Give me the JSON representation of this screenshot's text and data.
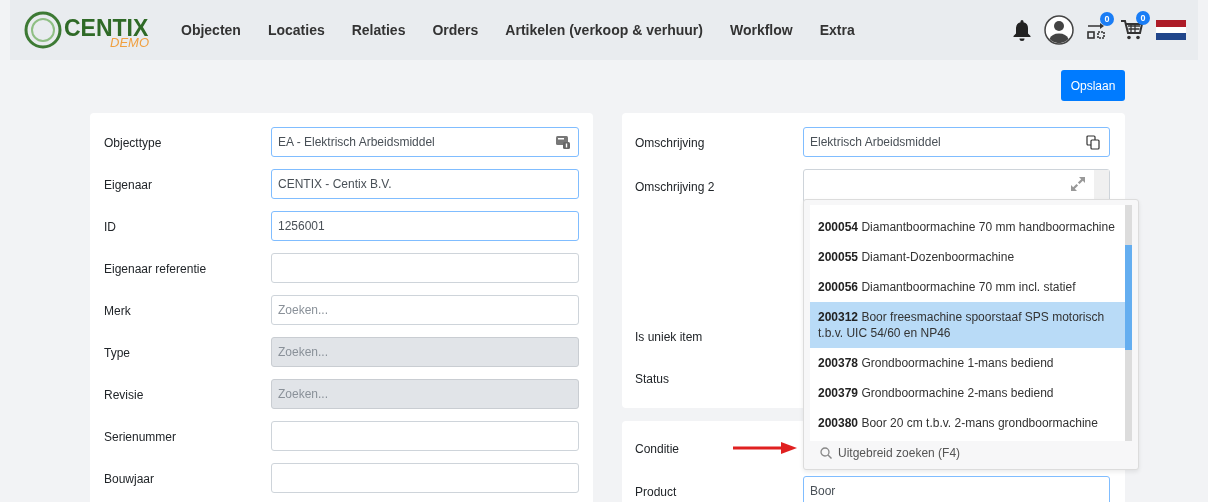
{
  "header": {
    "logo": {
      "wordmark": "CENTIX",
      "tag": "DEMO"
    },
    "nav": [
      "Objecten",
      "Locaties",
      "Relaties",
      "Orders",
      "Artikelen (verkoop & verhuur)",
      "Workflow",
      "Extra"
    ],
    "compare_count": "0",
    "cart_count": "0"
  },
  "toolbar": {
    "save_button": "Opslaan"
  },
  "left_card": {
    "fields": [
      {
        "label": "Objecttype",
        "kind": "lookup",
        "value": "EA - Elektrisch Arbeidsmiddel",
        "focused": true,
        "disabled": false
      },
      {
        "label": "Eigenaar",
        "kind": "text",
        "value": "CENTIX - Centix B.V.",
        "focused": true,
        "disabled": false
      },
      {
        "label": "ID",
        "kind": "text",
        "value": "1256001",
        "focused": true,
        "disabled": false
      },
      {
        "label": "Eigenaar referentie",
        "kind": "text",
        "focused": false,
        "disabled": false
      },
      {
        "label": "Merk",
        "kind": "text",
        "placeholder": "Zoeken...",
        "focused": false,
        "disabled": false
      },
      {
        "label": "Type",
        "kind": "text",
        "placeholder": "Zoeken...",
        "focused": false,
        "disabled": true
      },
      {
        "label": "Revisie",
        "kind": "text",
        "placeholder": "Zoeken...",
        "focused": false,
        "disabled": true
      },
      {
        "label": "Serienummer",
        "kind": "text",
        "focused": false,
        "disabled": false
      },
      {
        "label": "Bouwjaar",
        "kind": "text",
        "focused": false,
        "disabled": false
      }
    ]
  },
  "right_card": {
    "fields": [
      {
        "label": "Omschrijving",
        "kind": "copy",
        "value": "Elektrisch Arbeidsmiddel",
        "focused": true,
        "disabled": false
      },
      {
        "label": "Omschrijving 2",
        "kind": "textarea",
        "focused": false,
        "disabled": false
      },
      {
        "label": "Is uniek item",
        "kind": "hidden"
      },
      {
        "label": "Status",
        "kind": "hidden"
      }
    ]
  },
  "condition_card": {
    "fields": [
      {
        "label": "Conditie",
        "kind": "hidden"
      },
      {
        "label": "Product",
        "kind": "text",
        "value": "Boor",
        "focused": true,
        "disabled": false
      }
    ]
  },
  "dropdown": {
    "items": [
      {
        "code": "200054",
        "text": "Diamantboormachine 70 mm handboormachine",
        "selected": false
      },
      {
        "code": "200055",
        "text": "Diamant-Dozenboormachine",
        "selected": false
      },
      {
        "code": "200056",
        "text": "Diamantboormachine 70 mm incl. statief",
        "selected": false
      },
      {
        "code": "200312",
        "text": "Boor freesmachine spoorstaaf SPS motorisch t.b.v. UIC 54/60 en NP46",
        "selected": true
      },
      {
        "code": "200378",
        "text": "Grondboormachine 1-mans bediend",
        "selected": false
      },
      {
        "code": "200379",
        "text": "Grondboormachine 2-mans bediend",
        "selected": false
      },
      {
        "code": "200380",
        "text": "Boor 20 cm t.b.v. 2-mans grondboormachine",
        "selected": false
      }
    ],
    "footer": "Uitgebreid zoeken (F4)"
  }
}
